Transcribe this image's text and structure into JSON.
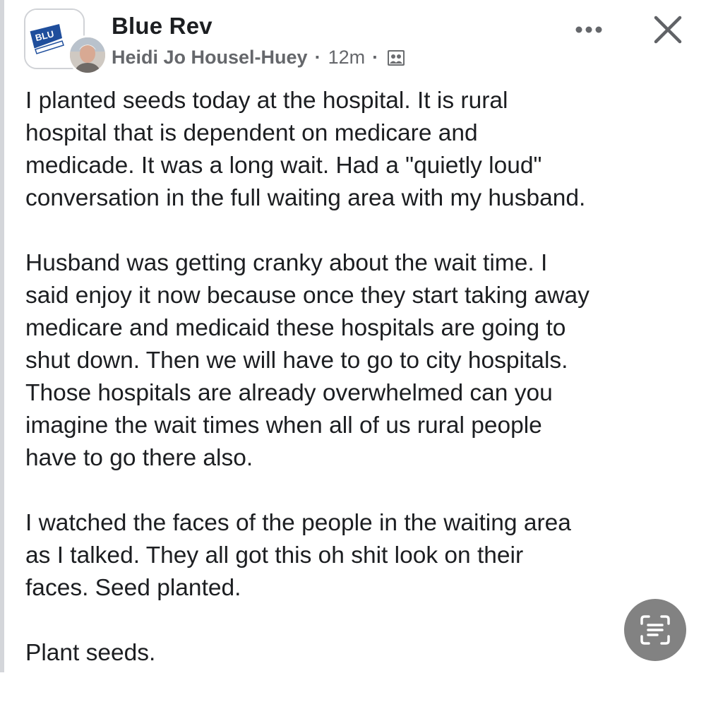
{
  "header": {
    "group_name": "Blue Rev",
    "author": "Heidi Jo Housel-Huey",
    "separator": "·",
    "time": "12m",
    "audience_icon": "group-members-icon",
    "more_icon": "more-options-icon",
    "close_icon": "close-icon"
  },
  "avatars": {
    "group_logo_text": "BLU"
  },
  "post": {
    "paragraphs": [
      "I planted seeds today at the hospital.  It is rural\nhospital that is dependent on medicare and\nmedicade.  It was a long wait.  Had a \"quietly loud\"\nconversation in the full waiting area with my husband.",
      "Husband was getting cranky about the wait time.  I\nsaid enjoy it now because once they start taking away\nmedicare and medicaid these hospitals are going to\nshut down.  Then we will have to go to city hospitals.\nThose hospitals are already overwhelmed can you\nimagine the wait times when all of us rural people\nhave to go there also.",
      "I watched the faces of the people in the waiting area\nas I talked.  They all got this oh shit look on their\nfaces.  Seed planted.",
      "Plant seeds."
    ]
  },
  "floating": {
    "scan_icon": "text-scan-icon"
  },
  "colors": {
    "text": "#1c1e21",
    "meta": "#65676b",
    "scan_button": "#828282",
    "brand_blue": "#1f4e9c"
  }
}
